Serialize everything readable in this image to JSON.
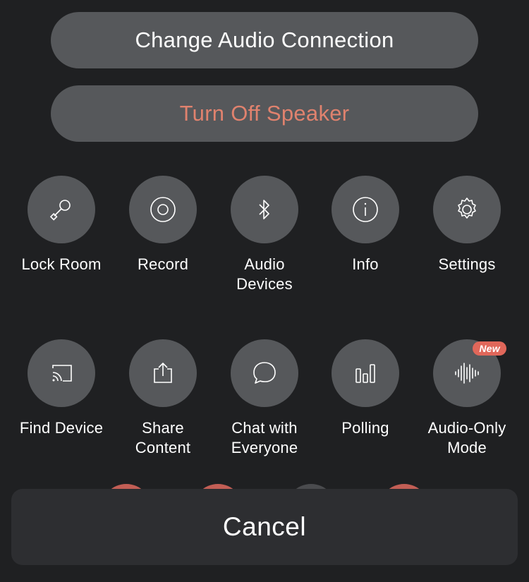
{
  "actions": {
    "change_audio": "Change Audio Connection",
    "speaker": "Turn Off Speaker"
  },
  "grid": [
    {
      "label": "Lock Room",
      "icon": "key-icon"
    },
    {
      "label": "Record",
      "icon": "record-icon"
    },
    {
      "label": "Audio\nDevices",
      "icon": "bluetooth-icon"
    },
    {
      "label": "Info",
      "icon": "info-icon"
    },
    {
      "label": "Settings",
      "icon": "gear-icon"
    },
    {
      "label": "Find Device",
      "icon": "cast-icon"
    },
    {
      "label": "Share\nContent",
      "icon": "share-icon"
    },
    {
      "label": "Chat with\nEveryone",
      "icon": "chat-bubble-icon"
    },
    {
      "label": "Polling",
      "icon": "poll-bars-icon"
    },
    {
      "label": "Audio-Only\nMode",
      "icon": "waveform-icon",
      "badge": "New"
    }
  ],
  "cancel_label": "Cancel",
  "colors": {
    "background": "#1f2022",
    "button": "#56585b",
    "accent": "#e0826e",
    "badge": "#e0675a",
    "sheet": "#2d2e31"
  }
}
